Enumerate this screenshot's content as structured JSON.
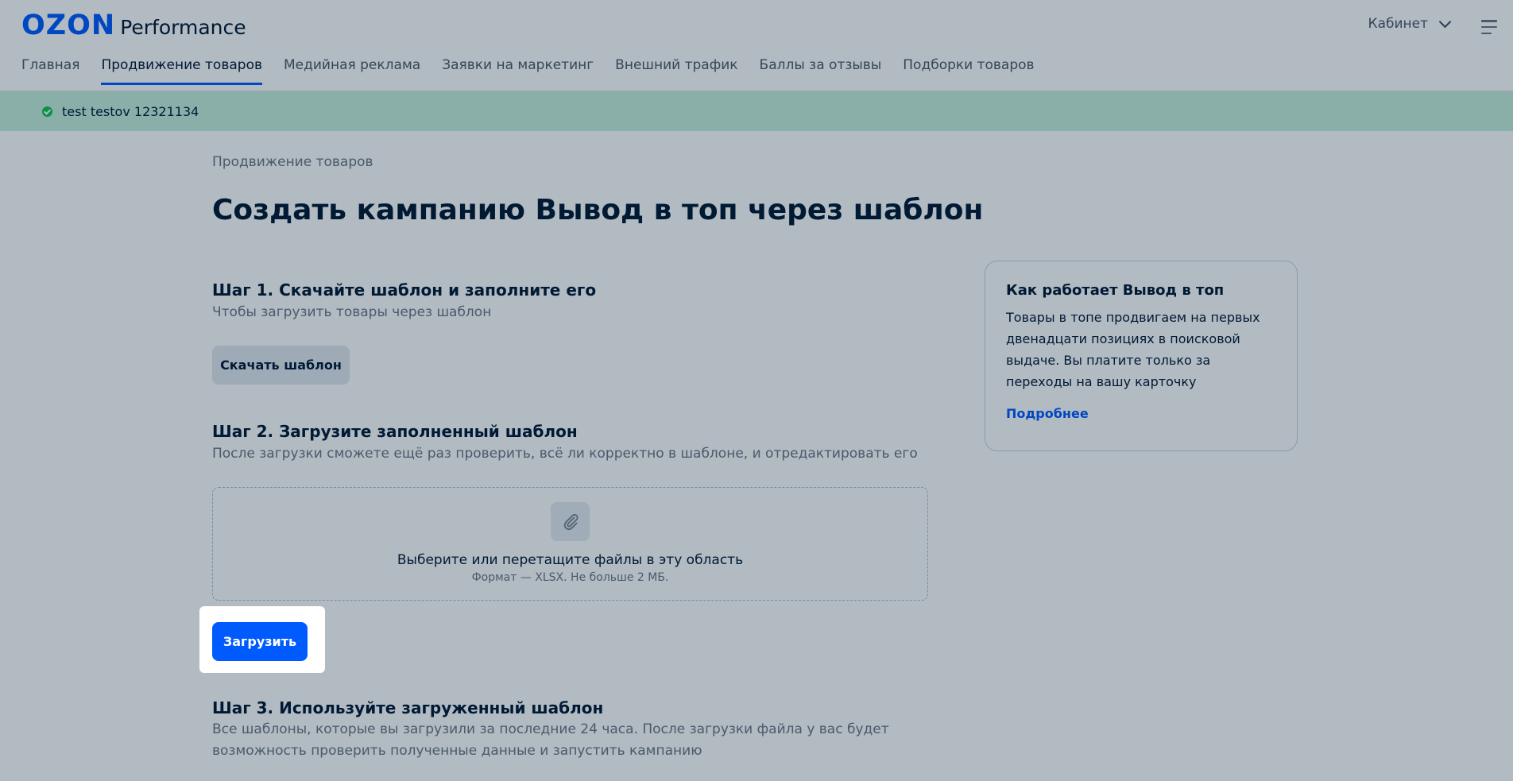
{
  "header": {
    "logo_brand": "OZON",
    "logo_product": "Performance",
    "cabinet_label": "Кабинет",
    "nav": [
      {
        "label": "Главная"
      },
      {
        "label": "Продвижение товаров"
      },
      {
        "label": "Медийная реклама"
      },
      {
        "label": "Заявки на маркетинг"
      },
      {
        "label": "Внешний трафик"
      },
      {
        "label": "Баллы за отзывы"
      },
      {
        "label": "Подборки товаров"
      }
    ]
  },
  "account": {
    "name": "test testov 12321134"
  },
  "main": {
    "breadcrumb": "Продвижение товаров",
    "title": "Создать кампанию Вывод в топ через шаблон",
    "step1": {
      "title": "Шаг 1. Скачайте шаблон и заполните его",
      "subtitle": "Чтобы загрузить товары через шаблон",
      "button": "Скачать шаблон"
    },
    "step2": {
      "title": "Шаг 2. Загрузите заполненный шаблон",
      "subtitle": "После загрузки сможете ещё раз проверить, всё ли корректно в шаблоне, и отредактировать его",
      "dropzone_text": "Выберите или перетащите файлы в эту область",
      "dropzone_hint": "Формат — XLSX. Не больше 2 МБ.",
      "button": "Загрузить"
    },
    "step3": {
      "title": "Шаг 3. Используйте загруженный шаблон",
      "subtitle": "Все шаблоны, которые вы загрузили за последние 24 часа. После загрузки файла у вас будет возможность проверить полученные данные и запустить кампанию"
    }
  },
  "info_card": {
    "title": "Как работает Вывод в топ",
    "text": "Товары в топе продвигаем на первых двенадцати позициях в поисковой выдаче. Вы платите только за переходы на вашу карточку",
    "link": "Подробнее"
  },
  "colors": {
    "accent": "#005bff",
    "success": "#10c44c",
    "account_bar": "#c6f0dc",
    "overlay": "rgba(0, 26, 52, 0.30)"
  }
}
